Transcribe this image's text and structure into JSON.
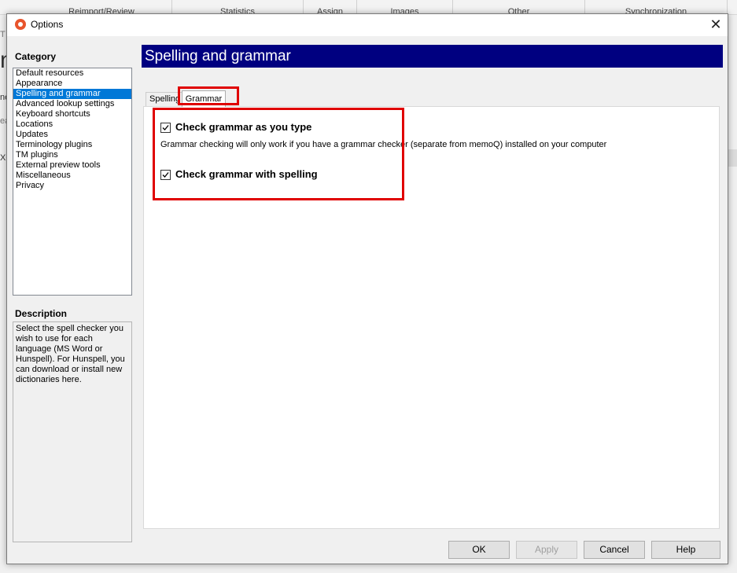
{
  "background": {
    "tabs": [
      "Reimport/Review",
      "Statistics",
      "Assign",
      "Images",
      "Other",
      "Synchronization"
    ],
    "fragments": [
      "T",
      "n",
      "ne",
      "ea",
      "XO"
    ]
  },
  "dialog": {
    "title": "Options",
    "close_symbol": "✕",
    "category_heading": "Category",
    "categories": [
      "Default resources",
      "Appearance",
      "Spelling and grammar",
      "Advanced lookup settings",
      "Keyboard shortcuts",
      "Locations",
      "Updates",
      "Terminology plugins",
      "TM plugins",
      "External preview tools",
      "Miscellaneous",
      "Privacy"
    ],
    "selected_category": "Spelling and grammar",
    "description_heading": "Description",
    "description_text": "Select the spell checker you wish to use for each language (MS Word or Hunspell). For Hunspell, you can download or install new dictionaries here.",
    "section_title": "Spelling and grammar",
    "tabs": [
      "Spelling",
      "Grammar"
    ],
    "active_tab": "Grammar",
    "options": {
      "check_as_you_type": {
        "label": "Check grammar as you type",
        "checked": true
      },
      "note": "Grammar checking will only work if you have a grammar checker (separate from memoQ) installed on your computer",
      "check_with_spelling": {
        "label": "Check grammar with spelling",
        "checked": true
      }
    },
    "buttons": {
      "ok": "OK",
      "apply": "Apply",
      "cancel": "Cancel",
      "help": "Help"
    }
  },
  "colors": {
    "banner": "#000080",
    "selection": "#0078d7",
    "highlight": "#e00000"
  }
}
